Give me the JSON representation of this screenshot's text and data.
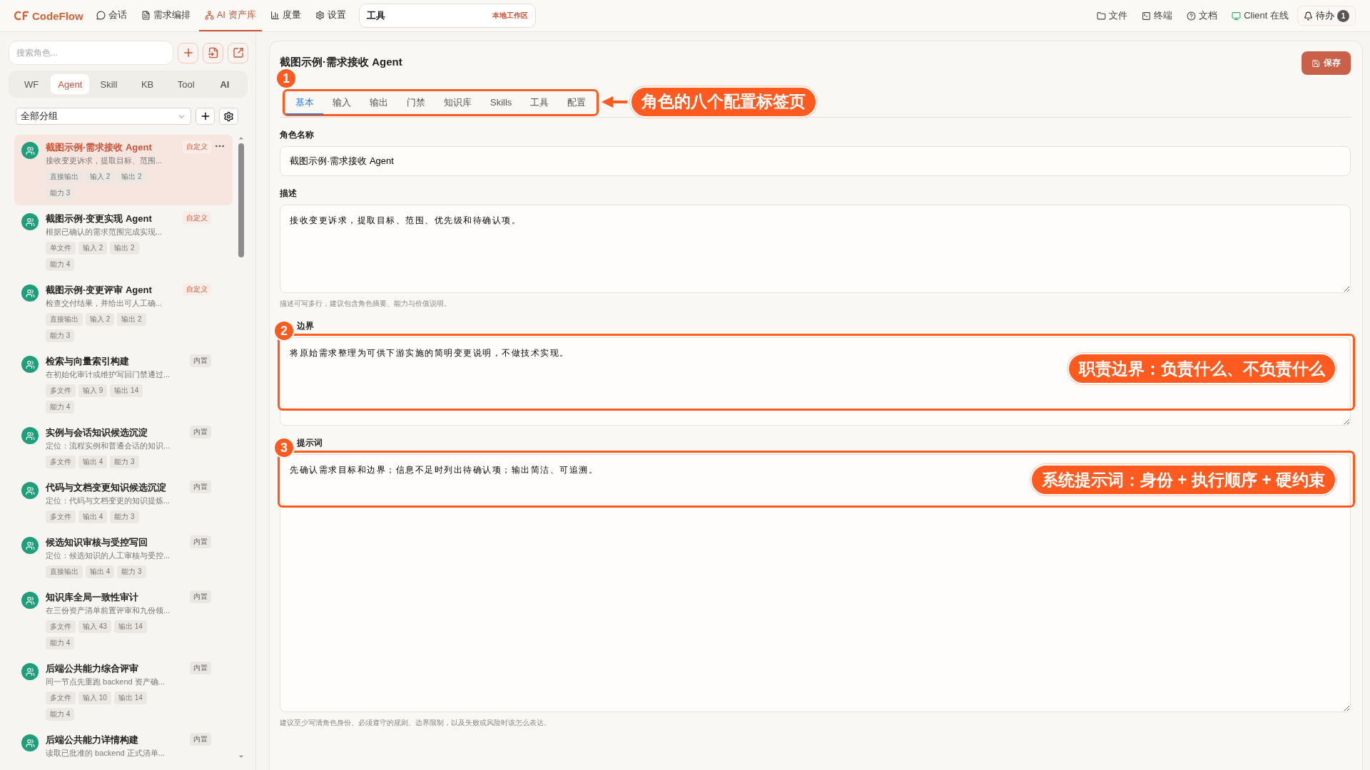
{
  "topbar": {
    "logo": "CodeFlow",
    "nav": [
      {
        "label": "会话",
        "selected": false
      },
      {
        "label": "需求编排",
        "selected": false
      },
      {
        "label": "AI 资产库",
        "selected": true
      },
      {
        "label": "度量",
        "selected": false
      },
      {
        "label": "设置",
        "selected": false
      }
    ],
    "workspace": {
      "title": "工具",
      "tag": "本地工作区"
    },
    "actions": [
      {
        "label": "文件"
      },
      {
        "label": "终端"
      },
      {
        "label": "文档"
      },
      {
        "label": "Client 在线"
      }
    ],
    "todo": {
      "label": "待办",
      "count": "1"
    }
  },
  "sidebar": {
    "search": {
      "placeholder": "搜索角色..."
    },
    "tabs": [
      {
        "label": "WF",
        "selected": false
      },
      {
        "label": "Agent",
        "selected": true
      },
      {
        "label": "Skill",
        "selected": false
      },
      {
        "label": "KB",
        "selected": false
      },
      {
        "label": "Tool",
        "selected": false
      },
      {
        "label": "AI",
        "selected": false
      }
    ],
    "group": "全部分组",
    "agents": [
      {
        "title": "截图示例·需求接收 Agent",
        "desc": "接收变更诉求，提取目标、范围...",
        "badge": "自定义",
        "kind": "custom",
        "selected": true,
        "tags": [
          "直接输出",
          "输入 2",
          "输出 2",
          "能力 3"
        ]
      },
      {
        "title": "截图示例·变更实现 Agent",
        "desc": "根据已确认的需求范围完成实现...",
        "badge": "自定义",
        "kind": "custom",
        "selected": false,
        "tags": [
          "单文件",
          "输入 2",
          "输出 2",
          "能力 4"
        ]
      },
      {
        "title": "截图示例·变更评审 Agent",
        "desc": "检查交付结果，并给出可人工确...",
        "badge": "自定义",
        "kind": "custom",
        "selected": false,
        "tags": [
          "直接输出",
          "输入 2",
          "输出 2",
          "能力 3"
        ]
      },
      {
        "title": "检索与向量索引构建",
        "desc": "在初始化审计或维护写回门禁通过...",
        "badge": "内置",
        "kind": "builtin",
        "selected": false,
        "tags": [
          "多文件",
          "输入 9",
          "输出 14",
          "能力 4"
        ]
      },
      {
        "title": "实例与会话知识候选沉淀",
        "desc": "定位：流程实例和普通会话的知识...",
        "badge": "内置",
        "kind": "builtin",
        "selected": false,
        "tags": [
          "多文件",
          "输出 4",
          "能力 3"
        ]
      },
      {
        "title": "代码与文档变更知识候选沉淀",
        "desc": "定位：代码与文档变更的知识提炼...",
        "badge": "内置",
        "kind": "builtin",
        "selected": false,
        "tags": [
          "多文件",
          "输出 4",
          "能力 3"
        ]
      },
      {
        "title": "候选知识审核与受控写回",
        "desc": "定位：候选知识的人工审核与受控...",
        "badge": "内置",
        "kind": "builtin",
        "selected": false,
        "tags": [
          "直接输出",
          "输出 4",
          "能力 3"
        ]
      },
      {
        "title": "知识库全局一致性审计",
        "desc": "在三份资产清单前置评审和九份领...",
        "badge": "内置",
        "kind": "builtin",
        "selected": false,
        "tags": [
          "多文件",
          "输入 43",
          "输出 14",
          "能力 4"
        ]
      },
      {
        "title": "后端公共能力综合评审",
        "desc": "同一节点先重跑 backend 资产确...",
        "badge": "内置",
        "kind": "builtin",
        "selected": false,
        "tags": [
          "多文件",
          "输入 10",
          "输出 14",
          "能力 4"
        ]
      },
      {
        "title": "后端公共能力详情构建",
        "desc": "读取已批准的 backend 正式清单...",
        "badge": "内置",
        "kind": "builtin",
        "selected": false
      }
    ]
  },
  "editor": {
    "title": "截图示例·需求接收 Agent",
    "save": "保存",
    "tabs": [
      {
        "label": "基本",
        "selected": true
      },
      {
        "label": "输入",
        "selected": false
      },
      {
        "label": "输出",
        "selected": false
      },
      {
        "label": "门禁",
        "selected": false
      },
      {
        "label": "知识库",
        "selected": false
      },
      {
        "label": "Skills",
        "selected": false
      },
      {
        "label": "工具",
        "selected": false
      },
      {
        "label": "配置",
        "selected": false
      }
    ],
    "fields": [
      {
        "label": "角色名称",
        "kind": "input",
        "value": "截图示例·需求接收 Agent"
      },
      {
        "label": "描述",
        "kind": "textarea",
        "value": "接收变更诉求，提取目标、范围、优先级和待确认项。",
        "hint": "描述可写多行，建议包含角色摘要、能力与价值说明。"
      },
      {
        "label": "边界",
        "kind": "textarea",
        "value": "将原始需求整理为可供下游实施的简明变更说明，不做技术实现。",
        "annotation": {
          "number": "2",
          "text": "职责边界：负责什么、不负责什么"
        }
      },
      {
        "label": "提示词",
        "kind": "tall",
        "value": "先确认需求目标和边界；信息不足时列出待确认项；输出简洁、可追溯。",
        "hint": "建议至少写清角色身份、必须遵守的规则、边界限制，以及失败或风险时该怎么表达。",
        "annotation": {
          "number": "3",
          "text": "系统提示词：身份 + 执行顺序 + 硬约束"
        }
      }
    ],
    "tabs_annotation": {
      "number": "1",
      "text": "角色的八个配置标签页"
    }
  }
}
